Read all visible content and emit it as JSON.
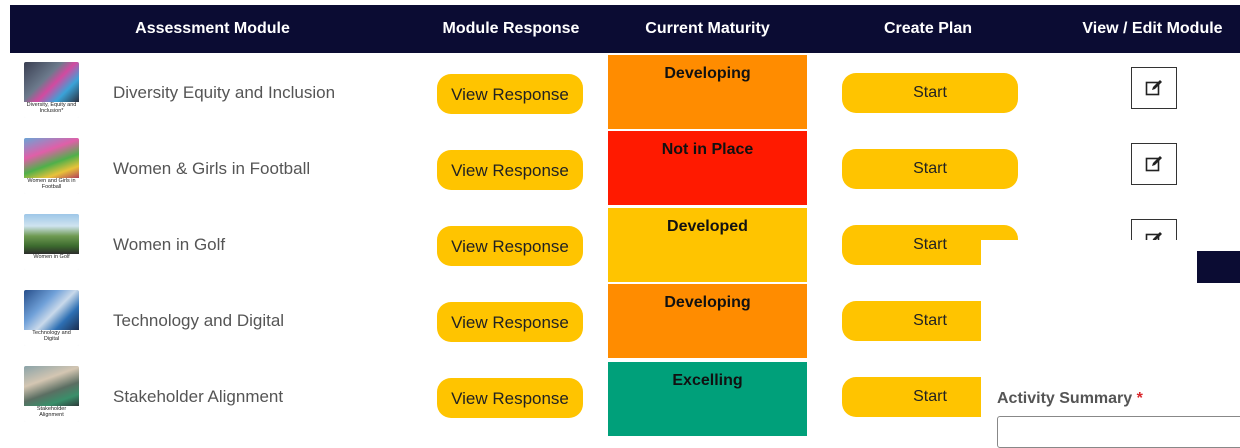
{
  "header": {
    "assessment_module": "Assessment Module",
    "module_response": "Module Response",
    "current_maturity": "Current Maturity",
    "create_plan": "Create Plan",
    "view_edit_module": "View / Edit Module"
  },
  "colors": {
    "header_bg": "#0b0c33",
    "button_yellow": "#ffc400",
    "developing": "#ff8c00",
    "not_in_place": "#ff1a00",
    "developed": "#ffc400",
    "excelling": "#00a07a"
  },
  "rows": [
    {
      "thumb_caption": "Diversity, Equity and Inclusion*",
      "name": "Diversity Equity and Inclusion",
      "response_label": "View Response",
      "maturity": "Developing",
      "plan_label": "Start",
      "edit_icon": "edit-icon"
    },
    {
      "thumb_caption": "Women and Girls in Football",
      "name": "Women & Girls in Football",
      "response_label": "View Response",
      "maturity": "Not in Place",
      "plan_label": "Start",
      "edit_icon": "edit-icon"
    },
    {
      "thumb_caption": "Women in Golf",
      "name": "Women in Golf",
      "response_label": "View Response",
      "maturity": "Developed",
      "plan_label": "Start",
      "edit_icon": "edit-icon"
    },
    {
      "thumb_caption": "Technology and Digital",
      "name": "Technology and Digital",
      "response_label": "View Response",
      "maturity": "Developing",
      "plan_label": "Start"
    },
    {
      "thumb_caption": "Stakeholder Alignment",
      "name": "Stakeholder Alignment",
      "response_label": "View Response",
      "maturity": "Excelling",
      "plan_label": "Start"
    }
  ],
  "overlay": {
    "activity_summary_label": "Activity Summary",
    "required_marker": "*"
  }
}
